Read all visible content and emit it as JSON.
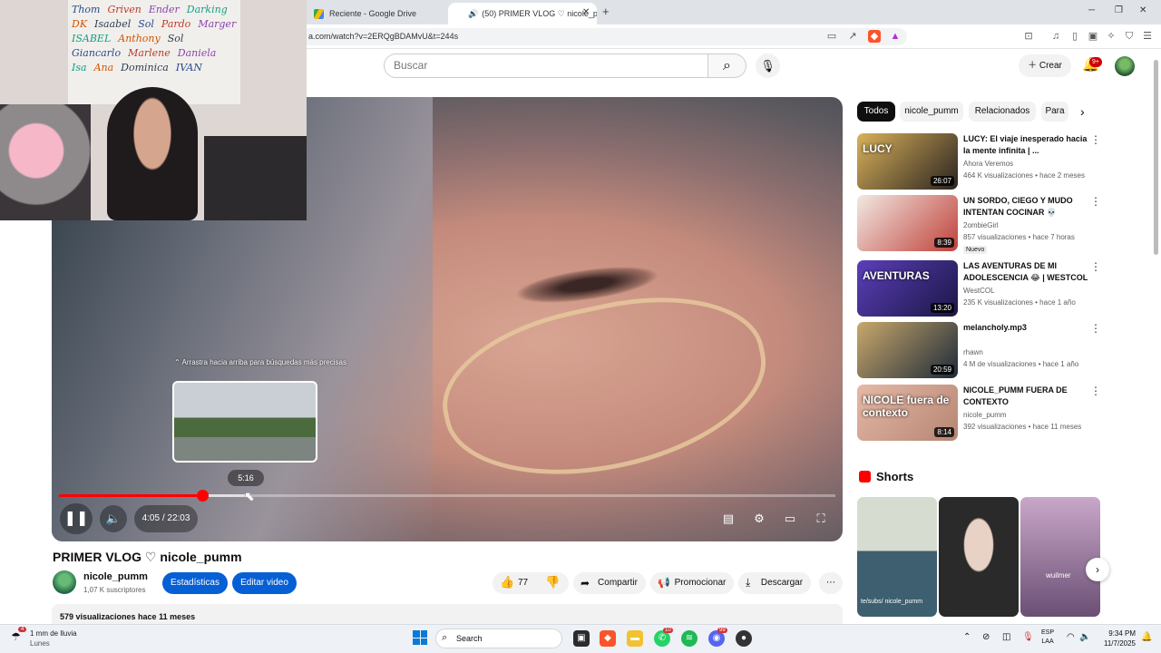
{
  "browser": {
    "tabs": [
      {
        "label": "Reciente - Google Drive",
        "active": false
      },
      {
        "label": "(50) PRIMER VLOG ♡ nicole_p",
        "active": true
      }
    ],
    "new_tab": "+",
    "url": "a.com/watch?v=2ERQgBDAMvU&t=244s",
    "window_controls": [
      "─",
      "❐",
      "✕"
    ]
  },
  "header": {
    "search_placeholder": "Buscar",
    "create_label": "Crear",
    "notifications_badge": "9+"
  },
  "webcam_names": [
    "Thom",
    "Griven",
    "Ender",
    "Darking",
    "DK",
    "Isaabel",
    "Sol",
    "Pardo",
    "Marger",
    "ISABEL",
    "Anthony",
    "Sol",
    "Giancarlo",
    "Marlene",
    "Daniela",
    "Isa",
    "Ana",
    "Dominica",
    "IVAN"
  ],
  "player": {
    "hint": "⌃ Arrastra hacia arriba para búsquedas más precisas",
    "hover_time": "5:16",
    "time": "4:05 / 22:03",
    "progress": 0.185,
    "hover_progress": 0.24
  },
  "video": {
    "title": "PRIMER VLOG ♡ nicole_pumm",
    "channel": "nicole_pumm",
    "subscribers": "1,07 K suscriptores",
    "btn_stats": "Estadísticas",
    "btn_edit": "Editar video",
    "likes": "77",
    "share": "Compartir",
    "promote": "Promocionar",
    "download": "Descargar",
    "views_date": "579 visualizaciones  hace 11 meses"
  },
  "chips": [
    "Todos",
    "nicole_pumm",
    "Relacionados",
    "Para"
  ],
  "related": [
    {
      "title": "LUCY: El viaje inesperado hacia la mente infinita | ...",
      "channel": "Ahora Veremos",
      "meta": "464 K visualizaciones • hace 2 meses",
      "duration": "26:07",
      "colorA": "#d8b15a",
      "colorB": "#2a2320",
      "thumb_text": "LUCY"
    },
    {
      "title": "UN SORDO, CIEGO Y MUDO INTENTAN COCINAR 💀",
      "channel": "2ombieGirl",
      "meta": "857 visualizaciones • hace 7 horas",
      "duration": "8:39",
      "colorA": "#f1e9e2",
      "colorB": "#c0413a",
      "badge": "Nuevo",
      "thumb_text": ""
    },
    {
      "title": "LAS AVENTURAS DE MI ADOLESCENCIA 😂 | WESTCOL",
      "channel": "WestCOL",
      "meta": "235 K visualizaciones • hace 1 año",
      "duration": "13:20",
      "colorA": "#5b3fb8",
      "colorB": "#1b1646",
      "thumb_text": "AVENTURAS"
    },
    {
      "title": "melancholy.mp3",
      "channel": "rhawn",
      "meta": "4 M de visualizaciones • hace 1 año",
      "duration": "20:59",
      "colorA": "#c8a86b",
      "colorB": "#1e2a3a",
      "thumb_text": ""
    },
    {
      "title": "NICOLE_PUMM FUERA DE CONTEXTO",
      "channel": "nicole_pumm",
      "meta": "392 visualizaciones • hace 11 meses",
      "duration": "8:14",
      "colorA": "#e5b9a6",
      "colorB": "#b58573",
      "thumb_text": "NICOLE fuera de contexto"
    }
  ],
  "shorts_label": "Shorts",
  "shorts_captions": [
    "te/subs/ nicole_pumm",
    "",
    "wuilmer"
  ],
  "taskbar": {
    "weather_title": "1 mm de lluvia",
    "weather_sub": "Lunes",
    "weather_badge": "4",
    "search": "Search",
    "lang_top": "ESP",
    "lang_bottom": "LAA",
    "time": "9:34 PM",
    "date": "11/7/2025",
    "app_badge_1": "10",
    "app_badge_2": "99"
  },
  "colors": {
    "accent_red": "#ff0000",
    "button_blue": "#065fd4"
  }
}
